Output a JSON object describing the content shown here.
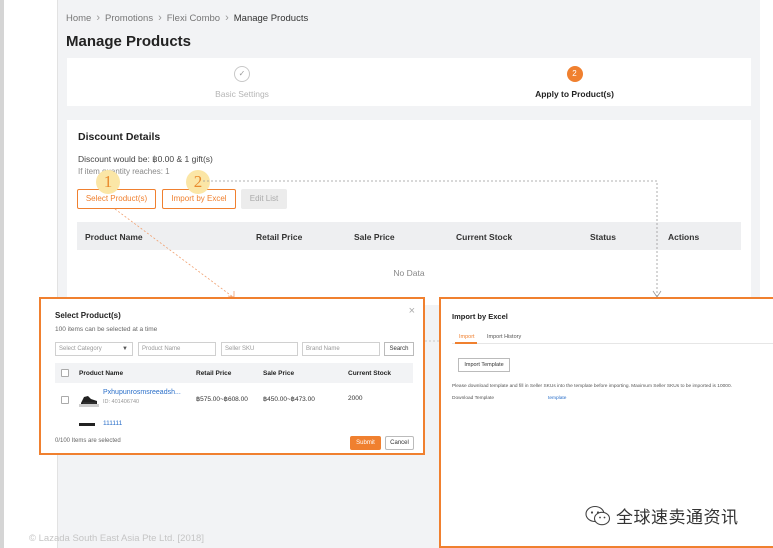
{
  "breadcrumb": [
    "Home",
    "Promotions",
    "Flexi Combo",
    "Manage Products"
  ],
  "page_title": "Manage Products",
  "steps": [
    {
      "number": "✓",
      "label": "Basic Settings",
      "state": "done"
    },
    {
      "number": "2",
      "label": "Apply to Product(s)",
      "state": "active"
    }
  ],
  "discount": {
    "title": "Discount Details",
    "line": "Discount would be: ฿0.00 & 1 gift(s)",
    "condition": "If item quantity reaches: 1",
    "buttons": {
      "select": "Select Product(s)",
      "import": "Import by Excel",
      "edit": "Edit List"
    },
    "table_headers": [
      "Product Name",
      "Retail Price",
      "Sale Price",
      "Current Stock",
      "Status",
      "Actions"
    ],
    "empty_text": "No Data"
  },
  "badges": [
    "1",
    "2"
  ],
  "select_modal": {
    "title": "Select Product(s)",
    "subtitle": "100 items can be selected at a time",
    "filters": {
      "category": "Select Category",
      "product_name": "Product Name",
      "seller_sku": "Seller SKU",
      "brand_name": "Brand Name",
      "search": "Search"
    },
    "columns": [
      "Product Name",
      "Retail Price",
      "Sale Price",
      "Current Stock"
    ],
    "rows": [
      {
        "name": "Pxhupunrosmsreeadsh...",
        "id": "ID: 401406740",
        "retail": "฿575.00~฿608.00",
        "sale": "฿450.00~฿473.00",
        "stock": "2000"
      }
    ],
    "row2_name": "111111",
    "selected_text": "0/100  Items are selected",
    "submit": "Submit",
    "cancel": "Cancel",
    "close": "×"
  },
  "import_modal": {
    "title": "Import by Excel",
    "tab_import": "Import",
    "tab_history": "Import History",
    "template_button": "Import Template",
    "description": "Please download template and fill in Seller SKUs into the template before importing. Maximum Seller SKUs to be imported is 10000.",
    "download_label": "Download Template",
    "download_link": "template"
  },
  "footer": {
    "copyright": "© Lazada South East Asia Pte Ltd. [2018]"
  },
  "watermark": {
    "text": "全球速卖通资讯"
  },
  "colors": {
    "accent": "#f0802f",
    "link": "#2a6fc9",
    "badge_bg": "#fbe6a6",
    "badge_text": "#e98b2e"
  },
  "icons": [
    "chevron-right-icon",
    "check-icon",
    "chevron-down-icon",
    "close-icon",
    "wechat-logo-icon"
  ]
}
